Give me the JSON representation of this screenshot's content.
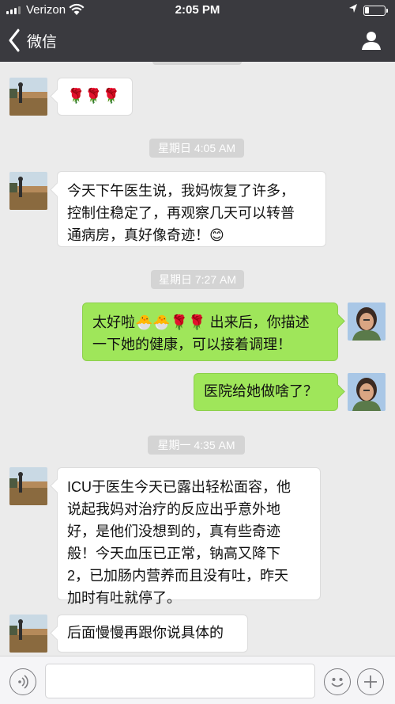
{
  "status_bar": {
    "carrier": "Verizon",
    "time": "2:05 PM"
  },
  "nav": {
    "back_label": "微信",
    "back_icon": "chevron-left-icon",
    "profile_icon": "person-icon"
  },
  "messages": [
    {
      "side": "left",
      "text": "🌹🌹🌹"
    },
    {
      "timestamp": "星期日 4:05 AM"
    },
    {
      "side": "left",
      "lines": [
        "今天下午医生说，我妈恢复了许多，",
        "控制住稳定了，再观察几天可以转普",
        "通病房，真好像奇迹！😊"
      ]
    },
    {
      "timestamp": "星期日 7:27 AM"
    },
    {
      "side": "right",
      "lines": [
        "太好啦🐣🐣🌹🌹 出来后，你描述",
        "一下她的健康，可以接着调理！"
      ]
    },
    {
      "side": "right",
      "text": "医院给她做啥了？"
    },
    {
      "timestamp": "星期一 4:35 AM"
    },
    {
      "side": "left",
      "lines": [
        "ICU于医生今天已露出轻松面容，他",
        "说起我妈对治疗的反应出乎意外地",
        "好，是他们没想到的，真有些奇迹",
        "般！今天血压已正常，钠高又降下",
        "2，已加肠内营养而且没有吐，昨天",
        "加时有吐就停了。"
      ]
    },
    {
      "side": "left",
      "text": "后面慢慢再跟你说具体的"
    }
  ],
  "composer": {
    "voice_icon": "voice-icon",
    "input_value": "",
    "emoji_icon": "smiley-icon",
    "plus_icon": "plus-icon"
  },
  "colors": {
    "header_bg": "#3a3a3f",
    "chat_bg": "#ebebeb",
    "sent_bubble": "#9fe65a",
    "received_bubble": "#ffffff"
  }
}
